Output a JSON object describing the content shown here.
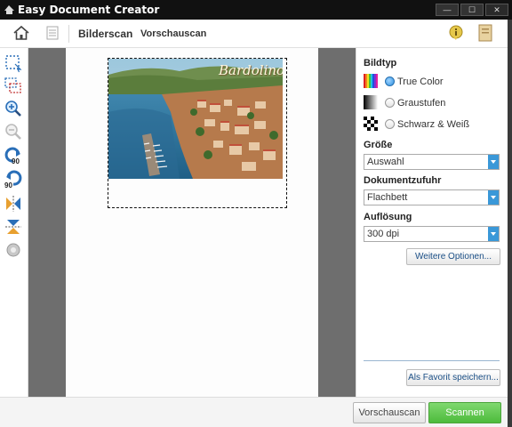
{
  "window": {
    "title": "Easy Document Creator",
    "controls": {
      "minimize": "—",
      "maximize": "☐",
      "close": "✕"
    }
  },
  "header": {
    "tab_main": "Bilderscan",
    "tab_preview": "Vorschauscan",
    "icons": [
      "home-icon",
      "list-icon",
      "info-icon",
      "document-icon"
    ]
  },
  "toolbar": {
    "tools": [
      "select-area-icon",
      "multi-select-icon",
      "zoom-in-icon",
      "zoom-out-icon",
      "rotate-left-90-icon",
      "rotate-right-90-icon",
      "flip-horizontal-icon",
      "flip-vertical-icon",
      "auto-adjust-icon"
    ],
    "rotate_label": "90"
  },
  "preview": {
    "postcard_text": "Bardolino"
  },
  "panel": {
    "image_type_label": "Bildtyp",
    "image_types": [
      {
        "label": "True Color",
        "selected": true
      },
      {
        "label": "Graustufen",
        "selected": false
      },
      {
        "label": "Schwarz & Weiß",
        "selected": false
      }
    ],
    "size_label": "Größe",
    "size_value": "Auswahl",
    "feed_label": "Dokumentzufuhr",
    "feed_value": "Flachbett",
    "resolution_label": "Auflösung",
    "resolution_value": "300 dpi",
    "more_options": "Weitere Optionen...",
    "save_favorite": "Als Favorit speichern..."
  },
  "footer": {
    "preview_button": "Vorschauscan",
    "scan_button": "Scannen"
  },
  "colors": {
    "accent": "#3a98d8",
    "scan_green": "#4dbb3c",
    "preview_bg": "#6e6e6e",
    "titlebar": "#111111"
  }
}
